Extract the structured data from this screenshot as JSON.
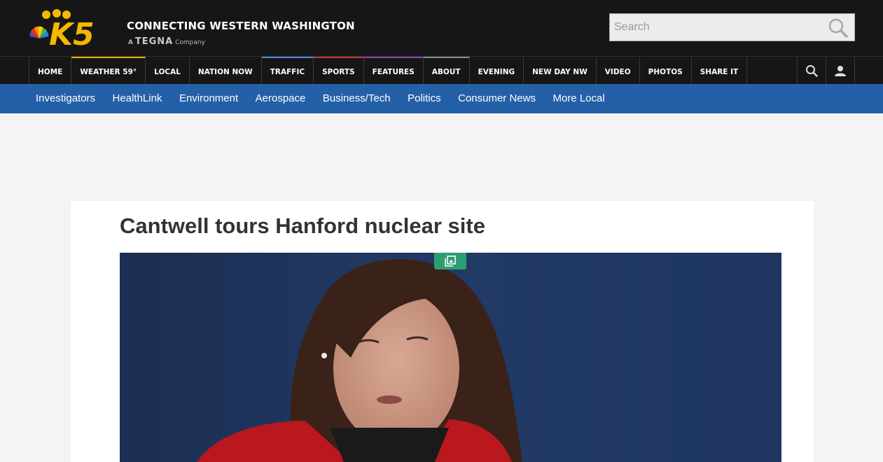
{
  "brand": {
    "logo_text": "K5",
    "tagline": "CONNECTING WESTERN WASHINGTON",
    "tegna_prefix": "A",
    "tegna_name": "TEGNA",
    "tegna_suffix": "Company",
    "logo_color": "#f5b800"
  },
  "search": {
    "placeholder": "Search",
    "value": ""
  },
  "nav": {
    "items": [
      {
        "label": "HOME",
        "accent": ""
      },
      {
        "label": "WEATHER 59°",
        "accent": "#e8b400"
      },
      {
        "label": "LOCAL",
        "accent": ""
      },
      {
        "label": "NATION NOW",
        "accent": ""
      },
      {
        "label": "TRAFFIC",
        "accent": "#4a90d9"
      },
      {
        "label": "SPORTS",
        "accent": "#c0392b"
      },
      {
        "label": "FEATURES",
        "accent": "#8e44ad"
      },
      {
        "label": "ABOUT",
        "accent": "#7f8c8d"
      },
      {
        "label": "EVENING",
        "accent": ""
      },
      {
        "label": "NEW DAY NW",
        "accent": ""
      },
      {
        "label": "VIDEO",
        "accent": ""
      },
      {
        "label": "PHOTOS",
        "accent": ""
      },
      {
        "label": "SHARE IT",
        "accent": ""
      }
    ],
    "tools": [
      "search-icon",
      "user-icon"
    ]
  },
  "subnav": {
    "items": [
      "Investigators",
      "HealthLink",
      "Environment",
      "Aerospace",
      "Business/Tech",
      "Politics",
      "Consumer News",
      "More Local"
    ]
  },
  "article": {
    "headline": "Cantwell tours Hanford nuclear site",
    "gallery_icon": "gallery-icon"
  },
  "colors": {
    "header_bg": "#161616",
    "subnav_bg": "#2460a7",
    "gallery_badge": "#2e9e72",
    "page_bg": "#f4f4f4"
  }
}
